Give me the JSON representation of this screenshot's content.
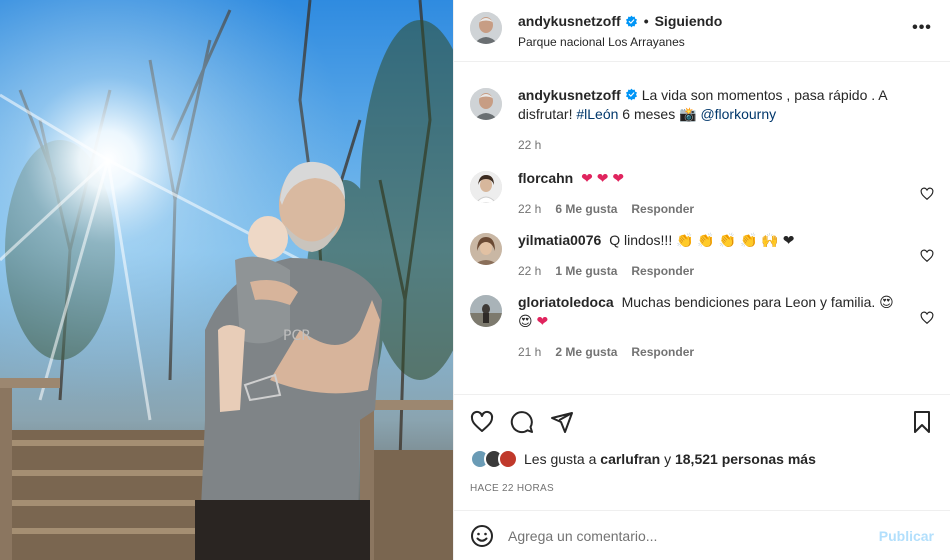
{
  "post": {
    "username": "andykusnetzoff",
    "follow_status": "Siguiendo",
    "location": "Parque nacional Los Arrayanes",
    "more_label": "•••"
  },
  "caption": {
    "username": "andykusnetzoff",
    "text": "La vida son momentos , pasa rápido . A disfrutar!",
    "hashtag": "#lLeón",
    "text2": "6 meses",
    "camera_emoji": "📸",
    "mention": "@florkourny",
    "time": "22 h"
  },
  "comments": [
    {
      "username": "florcahn",
      "text": "",
      "emoji": "❤ ❤ ❤",
      "time": "22 h",
      "likes": "6 Me gusta",
      "reply": "Responder"
    },
    {
      "username": "yilmatia0076",
      "text": "Q lindos!!!",
      "emoji": "👏 👏 👏 👏 🙌 ❤",
      "time": "22 h",
      "likes": "1 Me gusta",
      "reply": "Responder"
    },
    {
      "username": "gloriatoledoca",
      "text": "Muchas bendiciones para Leon y familia.",
      "emoji": "😍 😍",
      "emoji2": "❤",
      "time": "21 h",
      "likes": "2 Me gusta",
      "reply": "Responder"
    }
  ],
  "likes": {
    "prefix": "Les gusta a",
    "user": "carlufran",
    "conj": "y",
    "count": "18,521 personas más"
  },
  "timeago": "HACE 22 HORAS",
  "add_comment": {
    "placeholder": "Agrega un comentario...",
    "publish": "Publicar"
  },
  "colors": {
    "link": "#00376b",
    "meta": "#737373",
    "publish": "#b2dffc",
    "verified": "#0095f6"
  }
}
